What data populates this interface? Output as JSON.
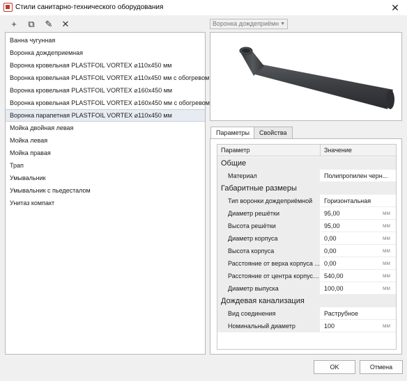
{
  "window": {
    "title": "Стили санитарно-технического оборудования",
    "close": "✕"
  },
  "toolbar": [
    {
      "name": "add-button",
      "icon": "plus-icon",
      "glyph": "+"
    },
    {
      "name": "copy-button",
      "icon": "copy-icon",
      "glyph": "⧉"
    },
    {
      "name": "edit-button",
      "icon": "pencil-icon",
      "glyph": "✎"
    },
    {
      "name": "delete-button",
      "icon": "close-icon",
      "glyph": "✕"
    }
  ],
  "type_select": {
    "value": "Воронка дождеприёмн",
    "arrow": "▼"
  },
  "list": [
    "Ванна чугунная",
    "Воронка дождеприемная",
    "Воронка кровельная PLASTFOIL VORTEX ⌀110x450 мм",
    "Воронка кровельная PLASTFOIL VORTEX ⌀110x450 мм с обогревом",
    "Воронка кровельная PLASTFOIL VORTEX ⌀160x450 мм",
    "Воронка кровельная PLASTFOIL VORTEX ⌀160x450 мм с обогревом",
    "Воронка парапетная PLASTFOIL VORTEX ⌀110x450 мм",
    "Мойка двойная левая",
    "Мойка левая",
    "Мойка правая",
    "Трап",
    "Умывальник",
    "Умывальник с пьедесталом",
    "Унитаз компакт"
  ],
  "selected_index": 6,
  "tabs": {
    "params": "Параметры",
    "props": "Свойства"
  },
  "grid": {
    "col_param": "Параметр",
    "col_value": "Значение",
    "groups": [
      {
        "title": "Общие",
        "rows": [
          {
            "name": "Материал",
            "value": "Полипропилен черн...",
            "unit": ""
          }
        ]
      },
      {
        "title": "Габаритные размеры",
        "rows": [
          {
            "name": "Тип воронки дождеприёмной",
            "value": "Горизонтальная",
            "unit": ""
          },
          {
            "name": "Диаметр решётки",
            "value": "95,00",
            "unit": "мм"
          },
          {
            "name": "Высота решётки",
            "value": "95,00",
            "unit": "мм"
          },
          {
            "name": "Диаметр корпуса",
            "value": "0,00",
            "unit": "мм"
          },
          {
            "name": "Высота корпуса",
            "value": "0,00",
            "unit": "мм"
          },
          {
            "name": "Расстояние от верха корпуса ...",
            "value": "0,00",
            "unit": "мм"
          },
          {
            "name": "Расстояние от центра корпуса...",
            "value": "540,00",
            "unit": "мм"
          },
          {
            "name": "Диаметр выпуска",
            "value": "100,00",
            "unit": "мм"
          }
        ]
      },
      {
        "title": "Дождевая канализация",
        "rows": [
          {
            "name": "Вид соединения",
            "value": "Раструбное",
            "unit": ""
          },
          {
            "name": "Номинальный диаметр",
            "value": "100",
            "unit": "мм"
          }
        ]
      }
    ]
  },
  "buttons": {
    "ok": "OK",
    "cancel": "Отмена"
  },
  "colors": {
    "model": "#3b3d40",
    "accent": "#c0392b"
  }
}
